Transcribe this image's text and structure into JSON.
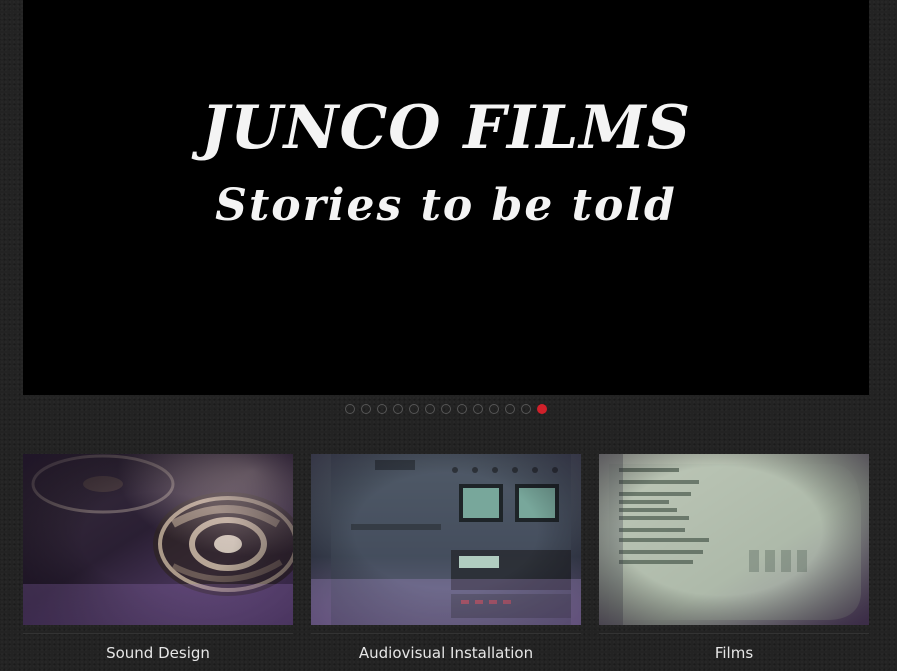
{
  "hero": {
    "title": "JUNCO FILMS",
    "subtitle": "Stories to be told",
    "background": "#000000"
  },
  "pager": {
    "count": 13,
    "active_index": 12,
    "active_color": "#d0202a"
  },
  "cards": [
    {
      "label": "Sound Design",
      "image": "reel-to-reel-tape-image"
    },
    {
      "label": "Audiovisual Installation",
      "image": "equipment-rack-image"
    },
    {
      "label": "Films",
      "image": "crt-monitor-terminal-image"
    }
  ]
}
